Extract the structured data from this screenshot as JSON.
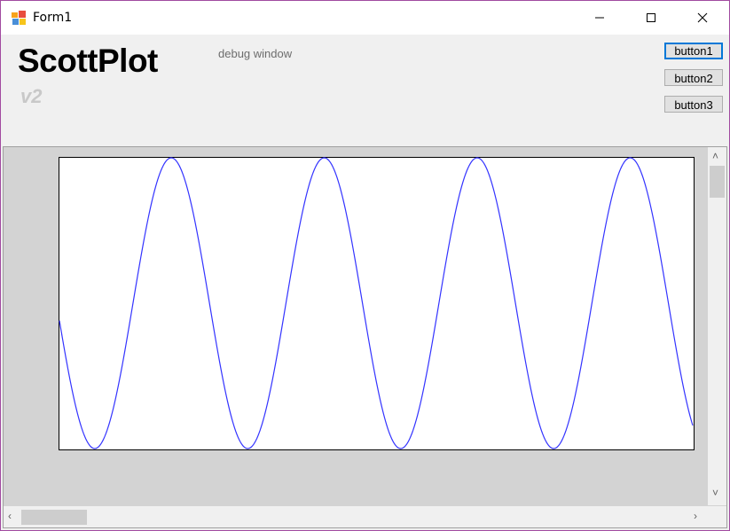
{
  "window": {
    "title": "Form1",
    "icons": {
      "app": "form-app-icon",
      "minimize": "minimize-icon",
      "maximize": "maximize-icon",
      "close": "close-icon"
    }
  },
  "header": {
    "brand": "ScottPlot",
    "version": "v2",
    "debug_label": "debug window"
  },
  "buttons": [
    "button1",
    "button2",
    "button3"
  ],
  "colors": {
    "plot_line": "#3333ff",
    "panel_bg": "#d3d3d3",
    "focus": "#0078d7"
  },
  "chart_data": {
    "type": "line",
    "function": "sine",
    "cycles_visible": 4.5,
    "amplitude": 1,
    "start_value": 0.0,
    "series": [
      {
        "values_note": ""
      }
    ],
    "title": "",
    "xlabel": "",
    "ylabel": "",
    "ylim": [
      -1,
      1
    ],
    "grid": false
  }
}
